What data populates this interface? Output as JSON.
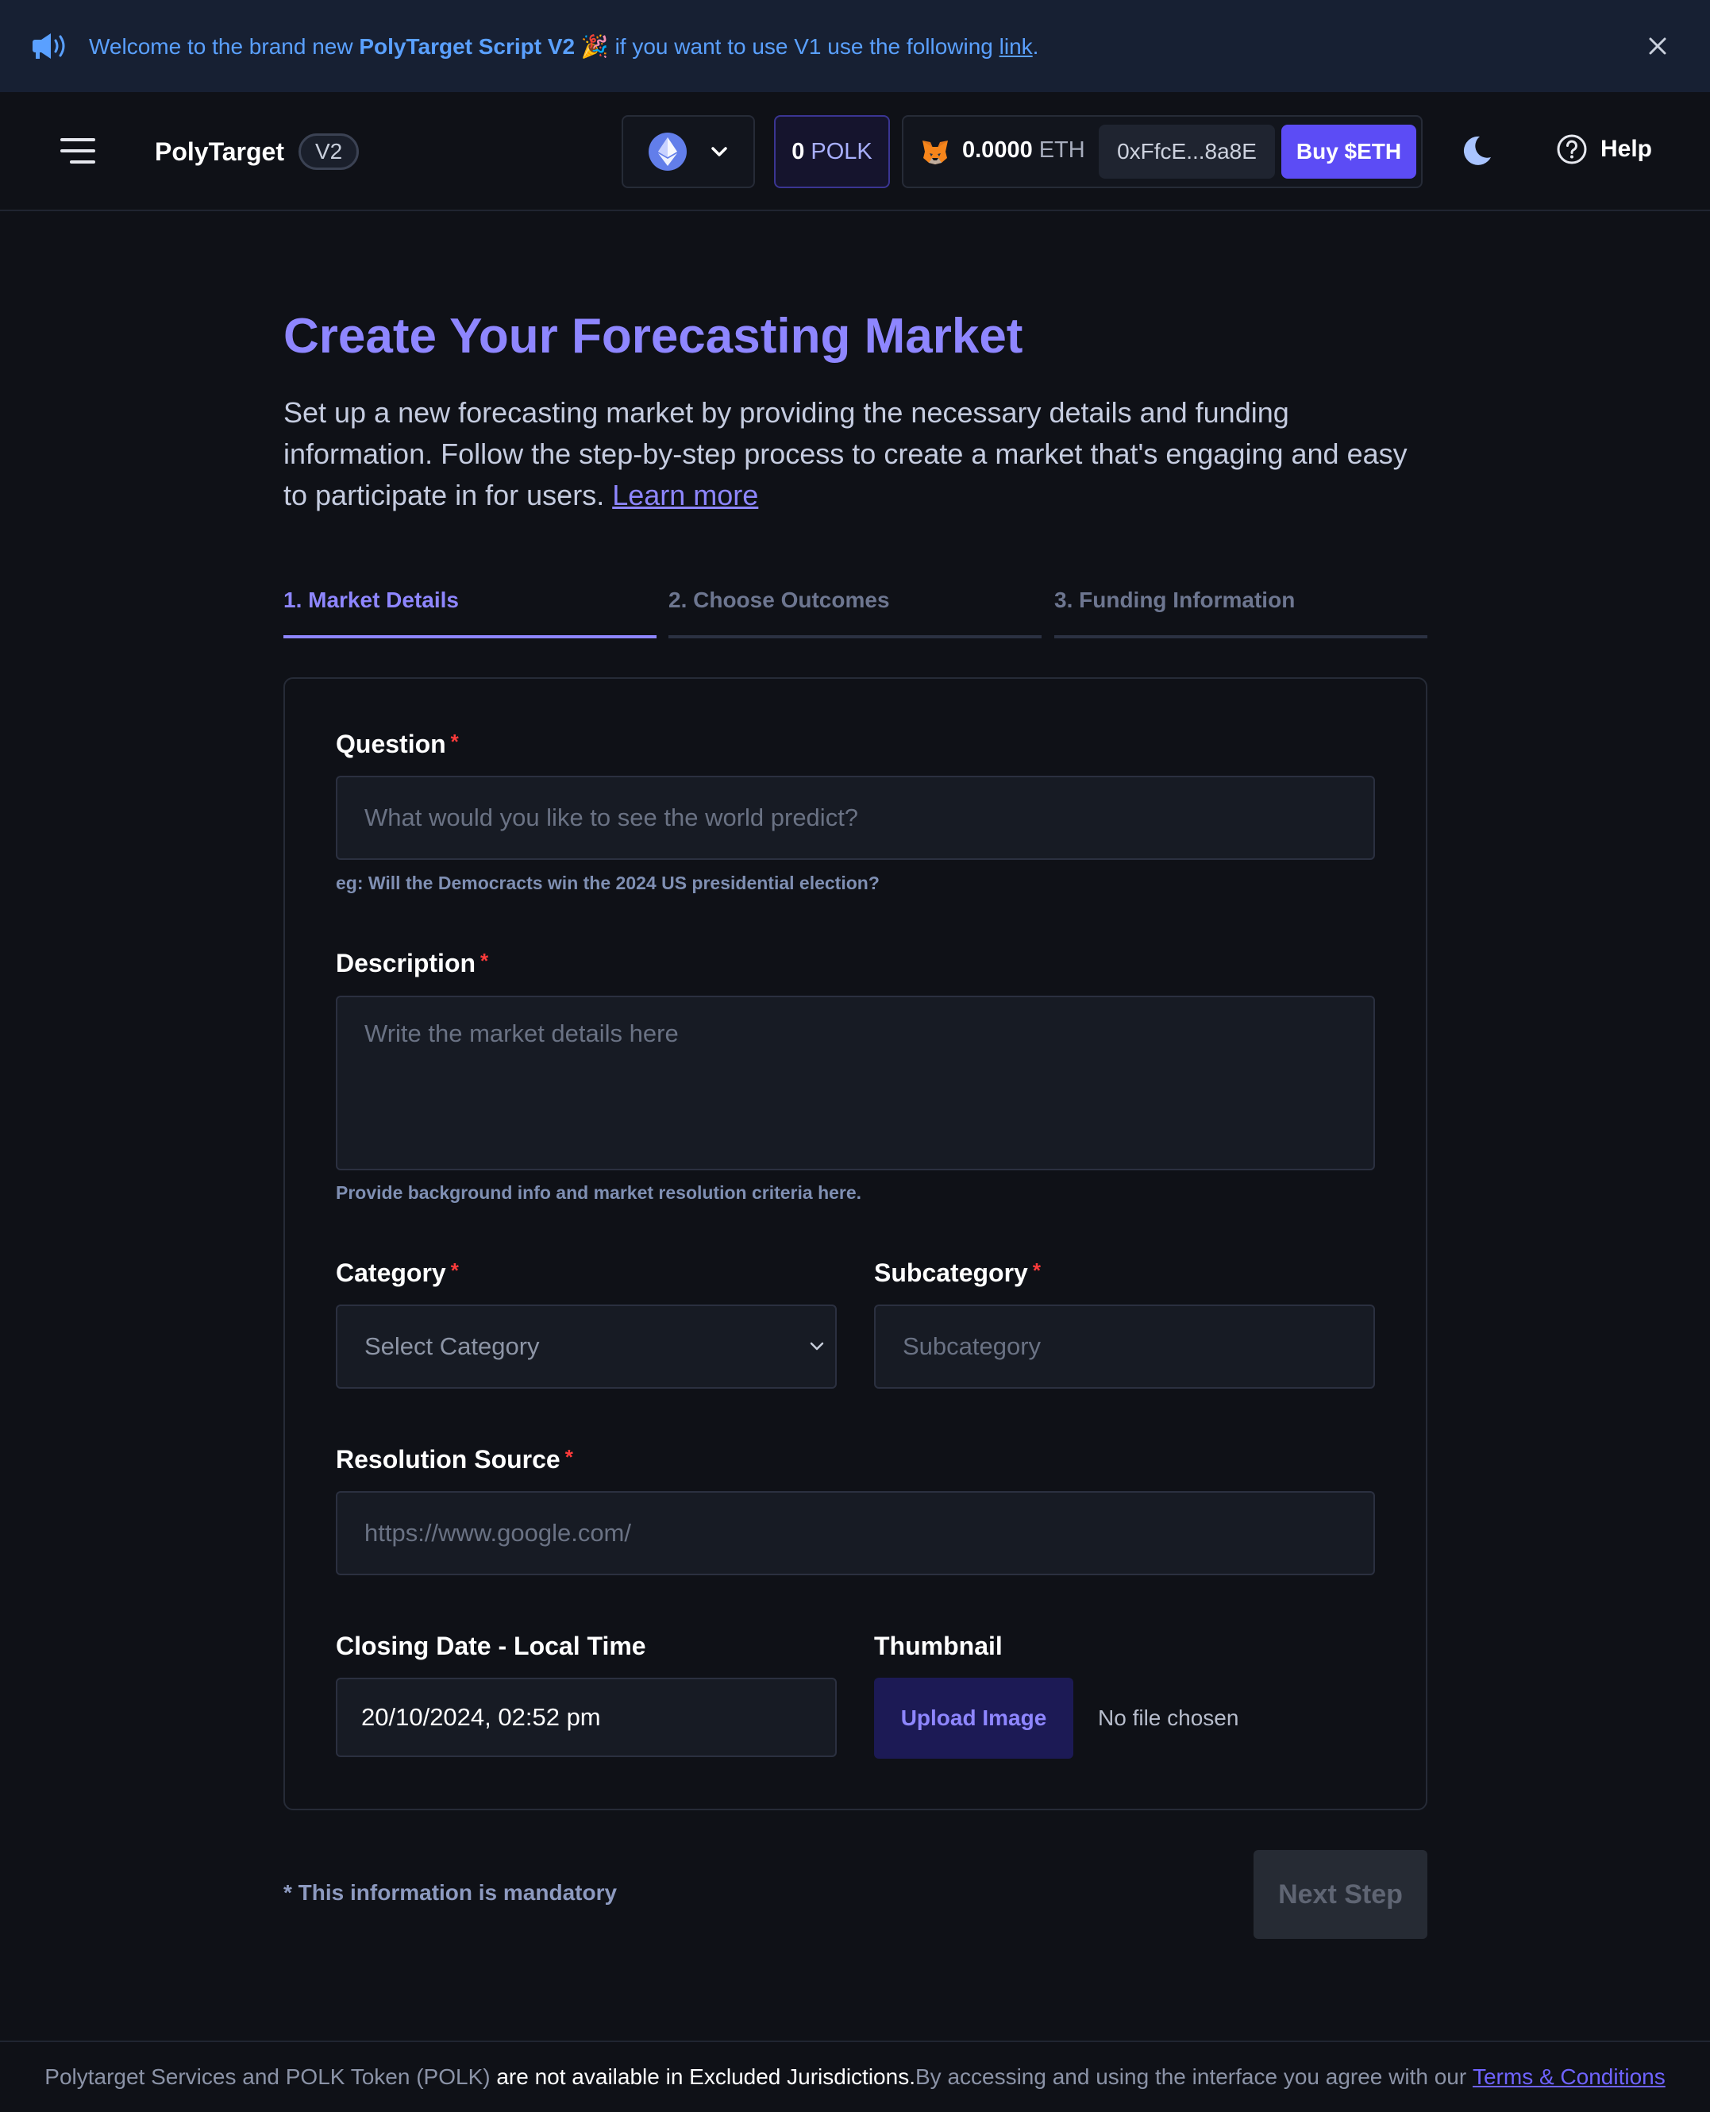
{
  "banner": {
    "prefix": "Welcome to the brand new ",
    "product": "PolyTarget Script V2",
    "emoji": "🎉",
    "middle": " if you want to use V1 use the following ",
    "link": "link",
    "suffix": "."
  },
  "header": {
    "brand": "PolyTarget",
    "version": "V2",
    "polk_amount": "0",
    "polk_symbol": "POLK",
    "eth_amount": "0.0000",
    "eth_symbol": "ETH",
    "address": "0xFfcE...8a8E",
    "buy_label": "Buy $ETH",
    "help_label": "Help"
  },
  "page": {
    "title": "Create Your Forecasting Market",
    "intro": "Set up a new forecasting market by providing the necessary details and funding information. Follow the step-by-step process to create a market that's engaging and easy to participate in for users. ",
    "learn_more": "Learn more"
  },
  "steps": [
    {
      "label": "1. Market Details",
      "active": true
    },
    {
      "label": "2. Choose Outcomes",
      "active": false
    },
    {
      "label": "3. Funding Information",
      "active": false
    }
  ],
  "form": {
    "required_mark": "*",
    "question": {
      "label": "Question",
      "placeholder": "What would you like to see the world predict?",
      "hint": "eg: Will the Democracts win the 2024 US presidential election?"
    },
    "description": {
      "label": "Description",
      "placeholder": "Write the market details here",
      "hint": "Provide background info and market resolution criteria here."
    },
    "category": {
      "label": "Category",
      "selected": "Select Category"
    },
    "subcategory": {
      "label": "Subcategory",
      "placeholder": "Subcategory"
    },
    "resolution_source": {
      "label": "Resolution Source",
      "placeholder": "https://www.google.com/"
    },
    "closing_date": {
      "label": "Closing Date - Local Time",
      "value": "20/10/2024, 02:52 pm"
    },
    "thumbnail": {
      "label": "Thumbnail",
      "button": "Upload Image",
      "status": "No file chosen"
    }
  },
  "footer_actions": {
    "mandatory_note": "* This information is mandatory",
    "next_label": "Next Step"
  },
  "footer": {
    "part1": "Polytarget Services and POLK Token (POLK) ",
    "part2": "are not available in Excluded Jurisdictions.",
    "part3": " By accessing and using the interface you agree with our ",
    "terms": "Terms & Conditions"
  },
  "colors": {
    "accent": "#8e86ff",
    "button_primary": "#5c4cf5",
    "banner_text": "#5aa0ff",
    "required": "#ff3b3b",
    "background": "#0f1117"
  },
  "icons": [
    "megaphone-icon",
    "close-icon",
    "hamburger-menu-icon",
    "ethereum-icon",
    "chevron-down-icon",
    "metamask-fox-icon",
    "moon-icon",
    "help-circle-icon"
  ]
}
